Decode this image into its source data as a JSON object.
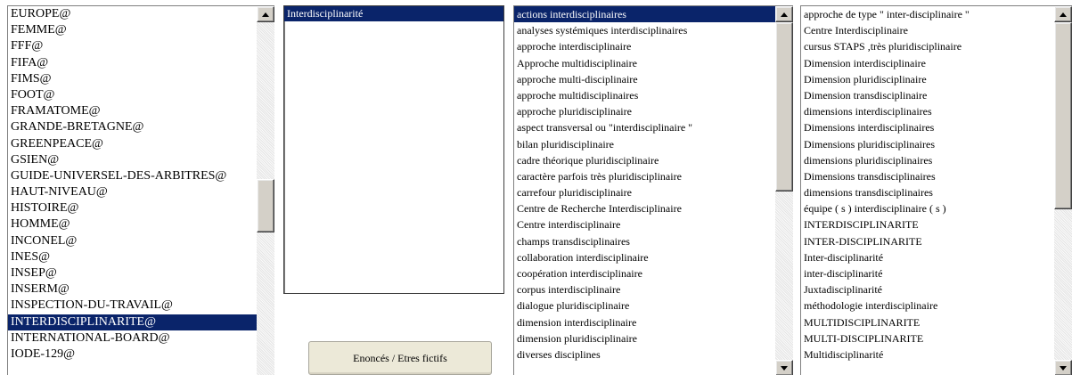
{
  "list_entities": {
    "items": [
      "EUROPE@",
      "FEMME@",
      "FFF@",
      "FIFA@",
      "FIMS@",
      "FOOT@",
      "FRAMATOME@",
      "GRANDE-BRETAGNE@",
      "GREENPEACE@",
      "GSIEN@",
      "GUIDE-UNIVERSEL-DES-ARBITRES@",
      "HAUT-NIVEAU@",
      "HISTOIRE@",
      "HOMME@",
      "INCONEL@",
      "INES@",
      "INSEP@",
      "INSERM@",
      "INSPECTION-DU-TRAVAIL@",
      "INTERDISCIPLINARITE@",
      "INTERNATIONAL-BOARD@",
      "IODE-129@"
    ],
    "selected_index": 19
  },
  "list_concept": {
    "items": [
      "Interdisciplinarité"
    ],
    "selected_index": 0
  },
  "list_expressions": {
    "items": [
      "actions interdisciplinaires",
      "analyses systémiques interdisciplinaires",
      "approche interdisciplinaire",
      "Approche multidisciplinaire",
      "approche multi-disciplinaire",
      "approche multidisciplinaires",
      "approche pluridisciplinaire",
      "aspect transversal ou \"interdisciplinaire \"",
      "bilan pluridisciplinaire",
      "cadre théorique pluridisciplinaire",
      "caractère parfois très pluridisciplinaire",
      "carrefour pluridisciplinaire",
      "Centre de Recherche Interdisciplinaire",
      "Centre interdisciplinaire",
      "champs transdisciplinaires",
      "collaboration interdisciplinaire",
      "coopération interdisciplinaire",
      "corpus interdisciplinaire",
      "dialogue pluridisciplinaire",
      "dimension interdisciplinaire",
      "dimension pluridisciplinaire",
      "diverses disciplines"
    ],
    "selected_index": 0
  },
  "list_variants": {
    "items": [
      "approche de type \" inter-disciplinaire \"",
      "Centre Interdisciplinaire",
      "cursus STAPS ,très pluridisciplinaire",
      "Dimension interdisciplinaire",
      "Dimension pluridisciplinaire",
      "Dimension transdisciplinaire",
      "dimensions interdisciplinaires",
      "Dimensions interdisciplinaires",
      "Dimensions pluridisciplinaires",
      "dimensions pluridisciplinaires",
      "Dimensions transdisciplinaires",
      "dimensions transdisciplinaires",
      "équipe ( s ) interdisciplinaire ( s )",
      "INTERDISCIPLINARITE",
      "INTER-DISCIPLINARITE",
      "Inter-disciplinarité",
      "inter-disciplinarité",
      "Juxtadisciplinarité",
      "méthodologie interdisciplinaire",
      "MULTIDISCIPLINARITE",
      "MULTI-DISCIPLINARITE",
      "Multidisciplinarité"
    ],
    "selected_index": -1
  },
  "buttons": {
    "enonces_label": "Enoncés / Etres fictifs"
  },
  "scroll_positions": {
    "entities": 0.55,
    "expressions": 0.5,
    "variants": 0.0
  },
  "colors": {
    "selection_bg": "#0a246a",
    "selection_fg": "#ffffff"
  }
}
